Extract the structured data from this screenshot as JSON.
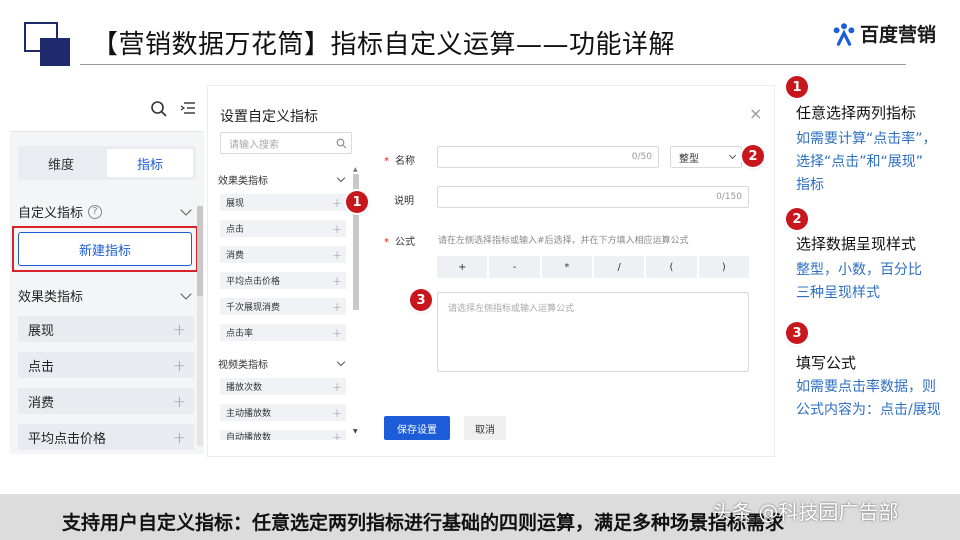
{
  "slide": {
    "title": "【营销数据万花筒】指标自定义运算——功能详解",
    "brand": "百度营销",
    "footer": "支持用户自定义指标：任意选定两列指标进行基础的四则运算，满足多种场景指标需求",
    "watermark": "头条 @科技园广告部"
  },
  "sidebar": {
    "tab_dimension": "维度",
    "tab_metric": "指标",
    "custom_header": "自定义指标",
    "help_glyph": "?",
    "new_button": "新建指标",
    "effect_header": "效果类指标",
    "items": [
      {
        "label": "展现"
      },
      {
        "label": "点击"
      },
      {
        "label": "消费"
      },
      {
        "label": "平均点击价格"
      }
    ]
  },
  "dialog": {
    "title": "设置自定义指标",
    "close": "×",
    "search_placeholder": "请输入搜索",
    "group_effect": "效果类指标",
    "effect_items": [
      "展现",
      "点击",
      "消费",
      "平均点击价格",
      "千次展现消费",
      "点击率"
    ],
    "group_video": "视频类指标",
    "video_items": [
      "播放次数",
      "主动播放数",
      "自动播放数"
    ],
    "name_label": "名称",
    "name_counter": "0/50",
    "format_value": "整型",
    "desc_label": "说明",
    "desc_counter": "0/150",
    "formula_label": "公式",
    "formula_hint": "请在左侧选择指标或输入#后选择，并在下方填入相应运算公式",
    "operators": [
      "+",
      "-",
      "*",
      "/",
      "(",
      ")"
    ],
    "formula_placeholder": "请选择左侧指标或输入运算公式",
    "save": "保存设置",
    "cancel": "取消"
  },
  "badges": [
    "1",
    "2",
    "3"
  ],
  "notes": [
    {
      "num": "1",
      "title": "任意选择两列指标",
      "lines": [
        "如需要计算“点击率”，",
        "选择“点击”和“展现”",
        "指标"
      ]
    },
    {
      "num": "2",
      "title": "选择数据呈现样式",
      "lines": [
        "整型，小数，百分比",
        "三种呈现样式"
      ]
    },
    {
      "num": "3",
      "title": "填写公式",
      "lines": [
        "如需要点击率数据，则",
        "公式内容为：点击/展现"
      ]
    }
  ],
  "colors": {
    "accent": "#1c5cd8",
    "badge": "#c8161d",
    "note": "#2e6fc4",
    "title_mark": "#1e2a6b"
  }
}
